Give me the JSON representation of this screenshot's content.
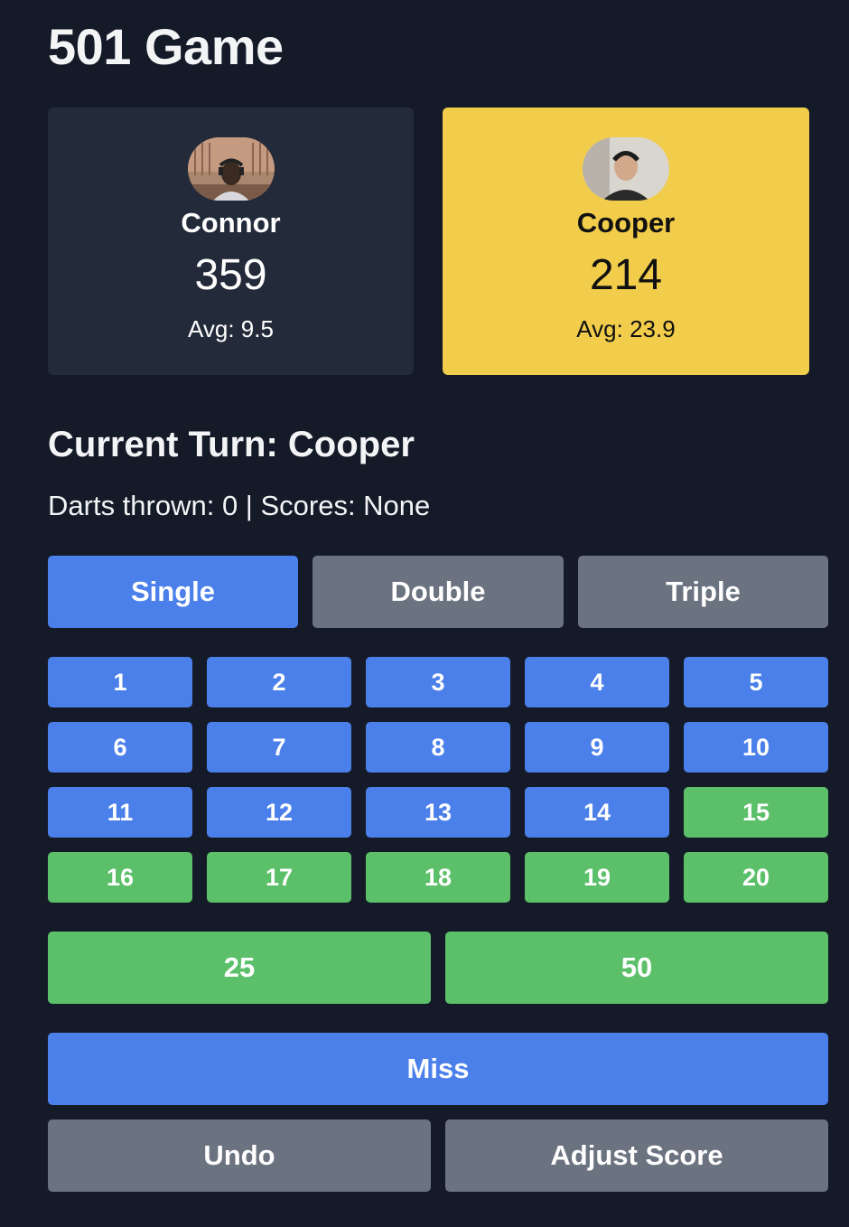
{
  "title": "501 Game",
  "players": [
    {
      "name": "Connor",
      "score": "359",
      "avg": "Avg: 9.5",
      "active": false
    },
    {
      "name": "Cooper",
      "score": "214",
      "avg": "Avg: 23.9",
      "active": true
    }
  ],
  "turn": {
    "label": "Current Turn: Cooper",
    "info": "Darts thrown: 0 | Scores: None"
  },
  "modes": {
    "single": "Single",
    "double": "Double",
    "triple": "Triple",
    "selected": "Single"
  },
  "numbers": [
    "1",
    "2",
    "3",
    "4",
    "5",
    "6",
    "7",
    "8",
    "9",
    "10",
    "11",
    "12",
    "13",
    "14",
    "15",
    "16",
    "17",
    "18",
    "19",
    "20"
  ],
  "bull": {
    "outer": "25",
    "inner": "50"
  },
  "actions": {
    "miss": "Miss",
    "undo": "Undo",
    "adjust": "Adjust Score"
  },
  "colors": {
    "background": "#141a27",
    "blue": "#4b80ea",
    "green": "#5bc069",
    "gray": "#6b7280",
    "active_card": "#f2cd4b",
    "inactive_card": "#232a3a"
  }
}
